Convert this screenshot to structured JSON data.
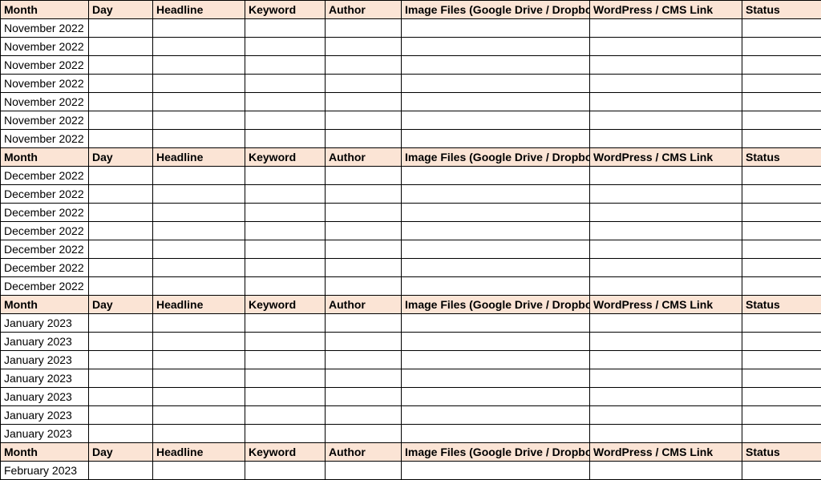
{
  "columns": {
    "month": "Month",
    "day": "Day",
    "headline": "Headline",
    "keyword": "Keyword",
    "author": "Author",
    "image": "Image Files (Google Drive / Dropbox Link)",
    "wp": "WordPress / CMS Link",
    "status": "Status"
  },
  "sections": [
    {
      "month_label": "November 2022",
      "rows": [
        {
          "day": "",
          "headline": "",
          "keyword": "",
          "author": "",
          "image": "",
          "wp": "",
          "status": ""
        },
        {
          "day": "",
          "headline": "",
          "keyword": "",
          "author": "",
          "image": "",
          "wp": "",
          "status": ""
        },
        {
          "day": "",
          "headline": "",
          "keyword": "",
          "author": "",
          "image": "",
          "wp": "",
          "status": ""
        },
        {
          "day": "",
          "headline": "",
          "keyword": "",
          "author": "",
          "image": "",
          "wp": "",
          "status": ""
        },
        {
          "day": "",
          "headline": "",
          "keyword": "",
          "author": "",
          "image": "",
          "wp": "",
          "status": ""
        },
        {
          "day": "",
          "headline": "",
          "keyword": "",
          "author": "",
          "image": "",
          "wp": "",
          "status": ""
        },
        {
          "day": "",
          "headline": "",
          "keyword": "",
          "author": "",
          "image": "",
          "wp": "",
          "status": ""
        }
      ]
    },
    {
      "month_label": "December 2022",
      "rows": [
        {
          "day": "",
          "headline": "",
          "keyword": "",
          "author": "",
          "image": "",
          "wp": "",
          "status": ""
        },
        {
          "day": "",
          "headline": "",
          "keyword": "",
          "author": "",
          "image": "",
          "wp": "",
          "status": ""
        },
        {
          "day": "",
          "headline": "",
          "keyword": "",
          "author": "",
          "image": "",
          "wp": "",
          "status": ""
        },
        {
          "day": "",
          "headline": "",
          "keyword": "",
          "author": "",
          "image": "",
          "wp": "",
          "status": ""
        },
        {
          "day": "",
          "headline": "",
          "keyword": "",
          "author": "",
          "image": "",
          "wp": "",
          "status": ""
        },
        {
          "day": "",
          "headline": "",
          "keyword": "",
          "author": "",
          "image": "",
          "wp": "",
          "status": ""
        },
        {
          "day": "",
          "headline": "",
          "keyword": "",
          "author": "",
          "image": "",
          "wp": "",
          "status": ""
        }
      ]
    },
    {
      "month_label": "January 2023",
      "rows": [
        {
          "day": "",
          "headline": "",
          "keyword": "",
          "author": "",
          "image": "",
          "wp": "",
          "status": ""
        },
        {
          "day": "",
          "headline": "",
          "keyword": "",
          "author": "",
          "image": "",
          "wp": "",
          "status": ""
        },
        {
          "day": "",
          "headline": "",
          "keyword": "",
          "author": "",
          "image": "",
          "wp": "",
          "status": ""
        },
        {
          "day": "",
          "headline": "",
          "keyword": "",
          "author": "",
          "image": "",
          "wp": "",
          "status": ""
        },
        {
          "day": "",
          "headline": "",
          "keyword": "",
          "author": "",
          "image": "",
          "wp": "",
          "status": ""
        },
        {
          "day": "",
          "headline": "",
          "keyword": "",
          "author": "",
          "image": "",
          "wp": "",
          "status": ""
        },
        {
          "day": "",
          "headline": "",
          "keyword": "",
          "author": "",
          "image": "",
          "wp": "",
          "status": ""
        }
      ]
    },
    {
      "month_label": "February 2023",
      "rows": [
        {
          "day": "",
          "headline": "",
          "keyword": "",
          "author": "",
          "image": "",
          "wp": "",
          "status": ""
        }
      ]
    }
  ]
}
